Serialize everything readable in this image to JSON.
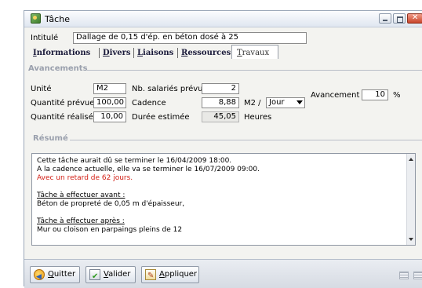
{
  "window": {
    "title": "Tâche"
  },
  "intitule": {
    "label": "Intitulé",
    "value": "Dallage de 0,15 d'ép. en béton dosé à 25"
  },
  "tabs": [
    {
      "label": "Informations",
      "accel": "I",
      "rest": "nformations"
    },
    {
      "label": "Divers",
      "accel": "D",
      "rest": "ivers"
    },
    {
      "label": "Liaisons",
      "accel": "L",
      "rest": "iaisons"
    },
    {
      "label": "Ressources",
      "accel": "R",
      "rest": "essources"
    },
    {
      "label": "Travaux",
      "accel": "T",
      "rest": "ravaux",
      "active": true
    }
  ],
  "avancements": {
    "section_title": "Avancements",
    "unite_label": "Unité",
    "unite_value": "M2",
    "nb_salaries_label": "Nb. salariés prévus",
    "nb_salaries_value": "2",
    "avancement_label": "Avancement",
    "avancement_value": "10",
    "avancement_unit": "%",
    "quantite_prevue_label": "Quantité prévue",
    "quantite_prevue_value": "100,00",
    "cadence_label": "Cadence",
    "cadence_value": "8,88",
    "cadence_unit": "M2 /",
    "cadence_period": "Jour",
    "quantite_realisee_label": "Quantité réalisée",
    "quantite_realisee_value": "10,00",
    "duree_label": "Durée estimée",
    "duree_value": "45,05",
    "duree_unit": "Heures"
  },
  "resume": {
    "section_title": "Résumé",
    "line1": "Cette tâche aurait dû se terminer le 16/04/2009 18:00.",
    "line2": "A la cadence actuelle, elle va se terminer le 16/07/2009 09:00.",
    "line3": "Avec un retard de 62 jours.",
    "before_title": "Tâche à effectuer avant :",
    "before_value": "Béton de propreté de 0,05 m d'épaisseur,",
    "after_title": "Tâche à effectuer après :",
    "after_value": "Mur ou cloison en parpaings pleins de 12"
  },
  "buttons": {
    "quitter_accel": "Q",
    "quitter_rest": "uitter",
    "valider_accel": "V",
    "valider_rest": "alider",
    "appliquer_accel": "A",
    "appliquer_rest": "ppliquer"
  },
  "colors": {
    "accent_red": "#d21e14",
    "section_title": "#9aa0ad"
  }
}
